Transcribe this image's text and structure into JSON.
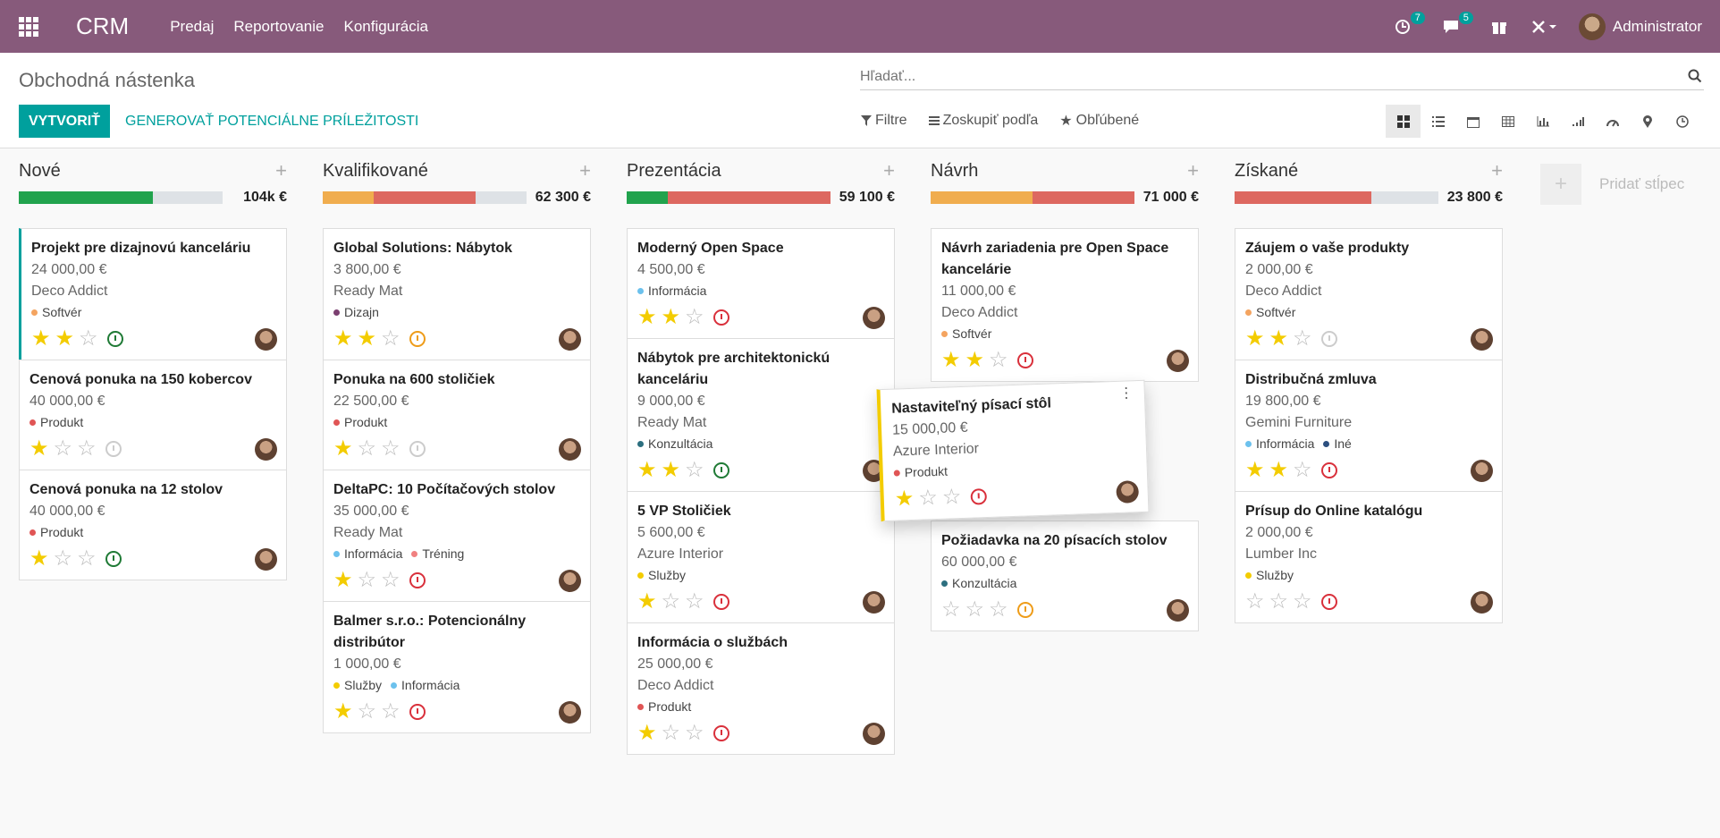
{
  "navbar": {
    "brand": "CRM",
    "menu": [
      "Predaj",
      "Reportovanie",
      "Konfigurácia"
    ],
    "activity_count": "7",
    "messages_count": "5",
    "user": "Administrator"
  },
  "control": {
    "title": "Obchodná nástenka",
    "search_placeholder": "Hľadať...",
    "create_label": "VYTVORIŤ",
    "generate_label": "GENEROVAŤ POTENCIÁLNE PRÍLEŽITOSTI",
    "filters_label": "Filtre",
    "groupby_label": "Zoskupiť podľa",
    "favorites_label": "Obľúbené"
  },
  "add_column_label": "Pridať stĺpec",
  "columns": [
    {
      "title": "Nové",
      "total": "104k €",
      "progress": [
        {
          "color": "#21a34d",
          "pct": 66
        }
      ],
      "cards": [
        {
          "title": "Projekt pre dizajnovú kanceláriu",
          "amount": "24 000,00 €",
          "partner": "Deco Addict",
          "tags": [
            {
              "label": "Softvér",
              "color": "#f4a460"
            }
          ],
          "stars": 2,
          "clock": "green",
          "highlight": true
        },
        {
          "title": "Cenová ponuka na 150 kobercov",
          "amount": "40 000,00 €",
          "partner": "",
          "tags": [
            {
              "label": "Produkt",
              "color": "#e05555"
            }
          ],
          "stars": 1,
          "clock": "grey"
        },
        {
          "title": "Cenová ponuka na 12 stolov",
          "amount": "40 000,00 €",
          "partner": "",
          "tags": [
            {
              "label": "Produkt",
              "color": "#e05555"
            }
          ],
          "stars": 1,
          "clock": "green"
        }
      ]
    },
    {
      "title": "Kvalifikované",
      "total": "62 300 €",
      "progress": [
        {
          "color": "#f0ad4e",
          "pct": 25
        },
        {
          "color": "#dd6860",
          "pct": 50
        }
      ],
      "cards": [
        {
          "title": "Global Solutions: Nábytok",
          "amount": "3 800,00 €",
          "partner": "Ready Mat",
          "tags": [
            {
              "label": "Dizajn",
              "color": "#7b3f70"
            }
          ],
          "stars": 2,
          "clock": "orange"
        },
        {
          "title": "Ponuka na 600 stoličiek",
          "amount": "22 500,00 €",
          "partner": "",
          "tags": [
            {
              "label": "Produkt",
              "color": "#e05555"
            }
          ],
          "stars": 1,
          "clock": "grey"
        },
        {
          "title": "DeltaPC: 10 Počítačových stolov",
          "amount": "35 000,00 €",
          "partner": "Ready Mat",
          "tags": [
            {
              "label": "Informácia",
              "color": "#6cc1ed"
            },
            {
              "label": "Tréning",
              "color": "#f08080"
            }
          ],
          "stars": 1,
          "clock": "red"
        },
        {
          "title": "Balmer s.r.o.: Potencionálny distribútor",
          "amount": "1 000,00 €",
          "partner": "",
          "tags": [
            {
              "label": "Služby",
              "color": "#f3cc00"
            },
            {
              "label": "Informácia",
              "color": "#6cc1ed"
            }
          ],
          "stars": 1,
          "clock": "red"
        }
      ]
    },
    {
      "title": "Prezentácia",
      "total": "59 100 €",
      "progress": [
        {
          "color": "#21a34d",
          "pct": 20
        },
        {
          "color": "#dd6860",
          "pct": 80
        }
      ],
      "cards": [
        {
          "title": "Moderný Open Space",
          "amount": "4 500,00 €",
          "partner": "",
          "tags": [
            {
              "label": "Informácia",
              "color": "#6cc1ed"
            }
          ],
          "stars": 2,
          "clock": "red"
        },
        {
          "title": "Nábytok pre architektonickú kanceláriu",
          "amount": "9 000,00 €",
          "partner": "Ready Mat",
          "tags": [
            {
              "label": "Konzultácia",
              "color": "#2c6f7f"
            }
          ],
          "stars": 2,
          "clock": "green"
        },
        {
          "title": "5 VP Stoličiek",
          "amount": "5 600,00 €",
          "partner": "Azure Interior",
          "tags": [
            {
              "label": "Služby",
              "color": "#f3cc00"
            }
          ],
          "stars": 1,
          "clock": "red"
        },
        {
          "title": "Informácia o službách",
          "amount": "25 000,00 €",
          "partner": "Deco Addict",
          "tags": [
            {
              "label": "Produkt",
              "color": "#e05555"
            }
          ],
          "stars": 1,
          "clock": "red"
        }
      ]
    },
    {
      "title": "Návrh",
      "total": "71 000 €",
      "progress": [
        {
          "color": "#f0ad4e",
          "pct": 50
        },
        {
          "color": "#dd6860",
          "pct": 50
        }
      ],
      "cards": [
        {
          "title": "Návrh zariadenia pre Open Space kancelárie",
          "amount": "11 000,00 €",
          "partner": "Deco Addict",
          "tags": [
            {
              "label": "Softvér",
              "color": "#f4a460"
            }
          ],
          "stars": 2,
          "clock": "red"
        },
        {
          "title": "Požiadavka na 20 písacích stolov",
          "amount": "60 000,00 €",
          "partner": "",
          "tags": [
            {
              "label": "Konzultácia",
              "color": "#2c6f7f"
            }
          ],
          "stars": 0,
          "clock": "orange",
          "gap_before": true
        }
      ]
    },
    {
      "title": "Získané",
      "total": "23 800 €",
      "progress": [
        {
          "color": "#dd6860",
          "pct": 67
        }
      ],
      "cards": [
        {
          "title": "Záujem o vaše produkty",
          "amount": "2 000,00 €",
          "partner": "Deco Addict",
          "tags": [
            {
              "label": "Softvér",
              "color": "#f4a460"
            }
          ],
          "stars": 2,
          "clock": "grey"
        },
        {
          "title": "Distribučná zmluva",
          "amount": "19 800,00 €",
          "partner": "Gemini Furniture",
          "tags": [
            {
              "label": "Informácia",
              "color": "#6cc1ed"
            },
            {
              "label": "Iné",
              "color": "#2c4f7f"
            }
          ],
          "stars": 2,
          "clock": "red"
        },
        {
          "title": "Prísup do Online katalógu",
          "amount": "2 000,00 €",
          "partner": "Lumber Inc",
          "tags": [
            {
              "label": "Služby",
              "color": "#f3cc00"
            }
          ],
          "stars": 0,
          "clock": "red"
        }
      ]
    }
  ],
  "dragged_card": {
    "title": "Nastaviteľný písací stôl",
    "amount": "15 000,00 €",
    "partner": "Azure Interior",
    "tags": [
      {
        "label": "Produkt",
        "color": "#e05555"
      }
    ],
    "stars": 1,
    "clock": "red"
  }
}
